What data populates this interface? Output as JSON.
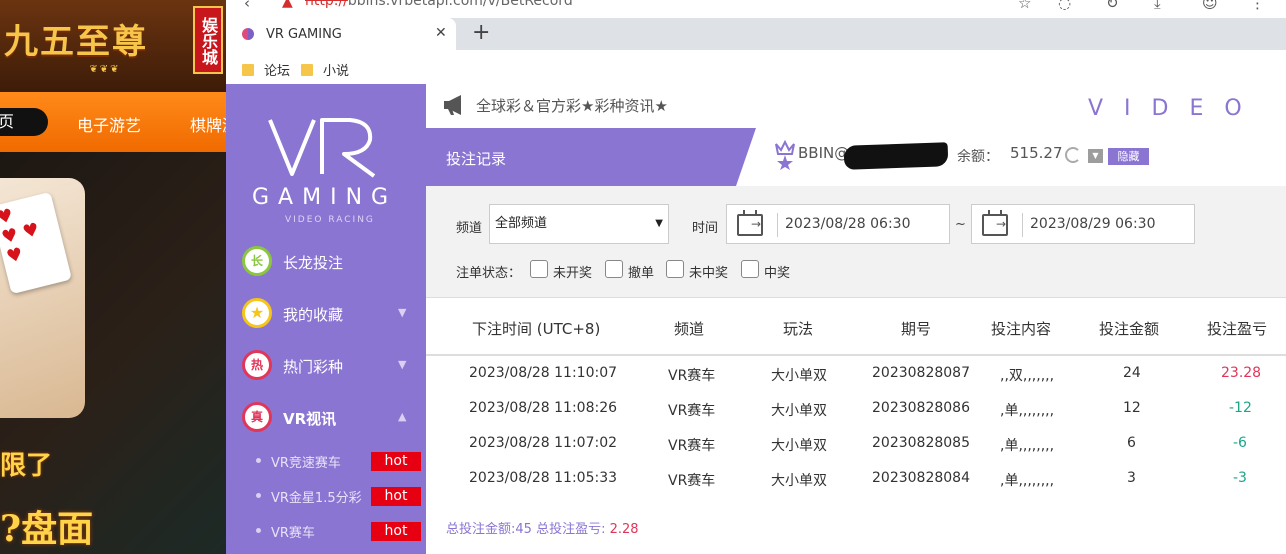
{
  "background_site": {
    "logo_text": "九五至尊",
    "badge_text": "娱乐城",
    "nav": {
      "home": "页",
      "games": "电子游艺",
      "chess": "棋牌游"
    },
    "promo_line1": "限了",
    "promo_line2": "?盘面"
  },
  "browser": {
    "url_scheme": "http://",
    "url_rest": "bbins.vrbetapi.com/v/BetRecord",
    "tab_title": "VR GAMING",
    "bookmarks": [
      "论坛",
      "小说"
    ]
  },
  "sidebar": {
    "logo_letters": "VR",
    "gaming": "GAMING",
    "video_racing": "VIDEO RACING",
    "items": [
      {
        "badge": "长",
        "label": "长龙投注",
        "color": "#8cc63f"
      },
      {
        "badge": "",
        "label": "我的收藏",
        "color": "#f5c518"
      },
      {
        "badge": "热",
        "label": "热门彩种",
        "color": "#e0365a"
      },
      {
        "badge": "真",
        "label": "VR视讯",
        "color": "#e0365a"
      }
    ],
    "sub_items": [
      {
        "label": "VR竞速赛车",
        "tag": "hot"
      },
      {
        "label": "VR金星1.5分彩",
        "tag": "hot"
      },
      {
        "label": "VR赛车",
        "tag": "hot"
      }
    ]
  },
  "header": {
    "notice": "全球彩＆官方彩★彩种资讯★",
    "brand_letters": "VIDEO R",
    "page_title": "投注记录",
    "username": "BBIN@",
    "balance_label": "余额：",
    "balance_value": "515.27",
    "hide_button": "隐藏"
  },
  "filters": {
    "channel_label": "频道",
    "channel_value": "全部频道",
    "time_label": "时间",
    "start": "2023/08/28 06:30",
    "end": "2023/08/29 06:30",
    "tilde": "~",
    "status_label": "注单状态：",
    "statuses": [
      "未开奖",
      "撤单",
      "未中奖",
      "中奖"
    ]
  },
  "table": {
    "columns": [
      "下注时间 (UTC+8)",
      "频道",
      "玩法",
      "期号",
      "投注内容",
      "投注金额",
      "投注盈亏"
    ],
    "rows": [
      {
        "time": "2023/08/28 11:10:07",
        "channel": "VR赛车",
        "play": "大小单双",
        "issue": "20230828087",
        "content": ",,双,,,,,,,",
        "amount": "24",
        "profit": "23.28"
      },
      {
        "time": "2023/08/28 11:08:26",
        "channel": "VR赛车",
        "play": "大小单双",
        "issue": "20230828086",
        "content": ",单,,,,,,,,",
        "amount": "12",
        "profit": "-12"
      },
      {
        "time": "2023/08/28 11:07:02",
        "channel": "VR赛车",
        "play": "大小单双",
        "issue": "20230828085",
        "content": ",单,,,,,,,,",
        "amount": "6",
        "profit": "-6"
      },
      {
        "time": "2023/08/28 11:05:33",
        "channel": "VR赛车",
        "play": "大小单双",
        "issue": "20230828084",
        "content": ",单,,,,,,,,",
        "amount": "3",
        "profit": "-3"
      }
    ]
  },
  "summary": {
    "total_amount_label": "总投注金额:",
    "total_amount": "45",
    "total_profit_label": "总投注盈亏:",
    "total_profit": "2.28"
  },
  "colors": {
    "brand_purple": "#8b75d2",
    "profit_positive": "#e0365a",
    "profit_negative": "#1aa68a",
    "hot_red": "#e60012"
  }
}
